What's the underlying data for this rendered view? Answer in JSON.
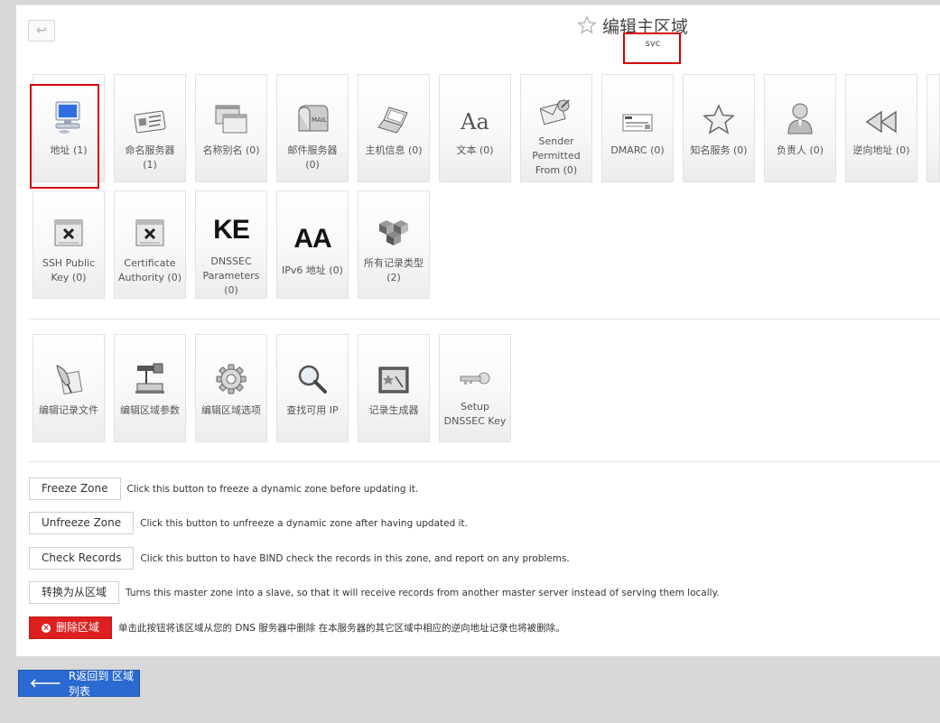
{
  "header": {
    "back_glyph": "↩",
    "title": "编辑主区域",
    "subtitle": "svc"
  },
  "record_types": [
    {
      "label": "地址 (1)",
      "icon": "computer-icon"
    },
    {
      "label": "命名服务器 (1)",
      "icon": "id-card-icon"
    },
    {
      "label": "名称别名 (0)",
      "icon": "windows-icon"
    },
    {
      "label": "邮件服务器 (0)",
      "icon": "mailbox-icon"
    },
    {
      "label": "主机信息 (0)",
      "icon": "laptop-icon"
    },
    {
      "label": "文本 (0)",
      "icon": "font-icon",
      "glyph": "Aa"
    },
    {
      "label": "Sender Permitted From (0)",
      "icon": "envelope-stamp-icon"
    },
    {
      "label": "DMARC (0)",
      "icon": "certificate-icon"
    },
    {
      "label": "知名服务 (0)",
      "icon": "star-icon"
    },
    {
      "label": "负责人 (0)",
      "icon": "person-icon"
    },
    {
      "label": "逆向地址 (0)",
      "icon": "rewind-icon"
    },
    {
      "label": "SSH Public Key (0)",
      "icon": "key-file-icon"
    },
    {
      "label": "Certificate Authority (0)",
      "icon": "key-file-icon"
    },
    {
      "label": "DNSSEC Parameters (0)",
      "icon": "ke-text-icon",
      "glyph": "KE"
    },
    {
      "label": "IPv6 地址 (0)",
      "icon": "aa-text-icon",
      "glyph": "AA"
    },
    {
      "label": "所有记录类型 (2)",
      "icon": "cubes-icon"
    }
  ],
  "tools": [
    {
      "label": "编辑记录文件",
      "icon": "quill-icon"
    },
    {
      "label": "编辑区域参数",
      "icon": "projector-icon"
    },
    {
      "label": "编辑区域选项",
      "icon": "gear-icon"
    },
    {
      "label": "查找可用 IP",
      "icon": "magnifier-icon"
    },
    {
      "label": "记录生成器",
      "icon": "generator-icon"
    },
    {
      "label": "Setup DNSSEC Key",
      "icon": "key-icon"
    }
  ],
  "actions": [
    {
      "button": "Freeze Zone",
      "desc": "Click this button to freeze a dynamic zone before updating it."
    },
    {
      "button": "Unfreeze Zone",
      "desc": "Click this button to unfreeze a dynamic zone after having updated it."
    },
    {
      "button": "Check Records",
      "desc": "Click this button to have BIND check the records in this zone, and report on any problems."
    },
    {
      "button": "转换为从区域",
      "desc": "Turns this master zone into a slave, so that it will receive records from another master server instead of serving them locally."
    },
    {
      "button": "删除区域",
      "desc": "单击此按钮将该区域从您的 DNS 服务器中删除 在本服务器的其它区域中相应的逆向地址记录也将被删除。"
    }
  ],
  "footer": {
    "return_label": "R返回到 区域列表"
  },
  "colors": {
    "danger": "#dd1f1f",
    "primary": "#2b6ad0",
    "highlight": "#d40000"
  }
}
